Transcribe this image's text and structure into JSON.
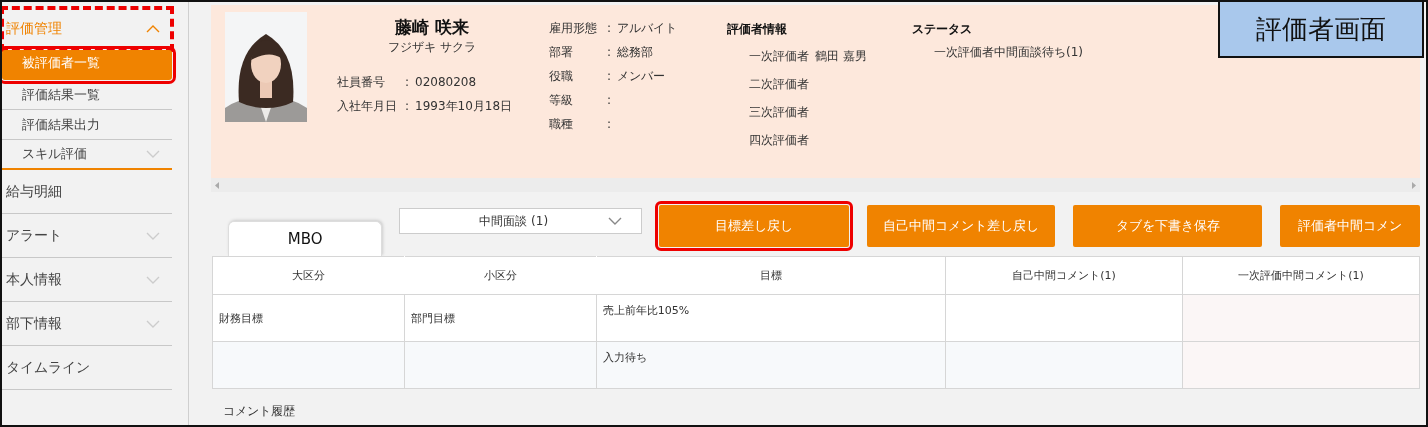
{
  "annotation_label": "評価者画面",
  "sidebar": {
    "items": [
      {
        "kind": "group",
        "label": "評価管理",
        "expanded": true,
        "annotated": true,
        "children": [
          {
            "label": "被評価者一覧",
            "selected": true,
            "annotated": true,
            "expandable": false
          },
          {
            "label": "評価結果一覧",
            "selected": false,
            "annotated": false,
            "expandable": false
          },
          {
            "label": "評価結果出力",
            "selected": false,
            "annotated": false,
            "expandable": false
          },
          {
            "label": "スキル評価",
            "selected": false,
            "annotated": false,
            "expandable": true
          }
        ]
      },
      {
        "kind": "link",
        "label": "給与明細",
        "annotated": false
      },
      {
        "kind": "group",
        "label": "アラート",
        "expanded": false,
        "annotated": false
      },
      {
        "kind": "group",
        "label": "本人情報",
        "expanded": false,
        "annotated": false
      },
      {
        "kind": "group",
        "label": "部下情報",
        "expanded": false,
        "annotated": false
      },
      {
        "kind": "link",
        "label": "タイムライン",
        "annotated": false
      }
    ]
  },
  "profile": {
    "name": "藤崎 咲来",
    "kana": "フジザキ サクラ",
    "id_fields": [
      {
        "label": "社員番号",
        "colon": ":",
        "value": "02080208"
      },
      {
        "label": "入社年月日",
        "colon": ":",
        "value": "1993年10月18日"
      }
    ],
    "job_fields": [
      {
        "label": "雇用形態",
        "colon": ":",
        "value": "アルバイト"
      },
      {
        "label": "部署",
        "colon": ":",
        "value": "総務部"
      },
      {
        "label": "役職",
        "colon": ":",
        "value": "メンバー"
      },
      {
        "label": "等級",
        "colon": ":"
      },
      {
        "label": "職種",
        "colon": ":"
      }
    ],
    "evaluators": {
      "title": "評価者情報",
      "rows": [
        {
          "label": "一次評価者",
          "name": "鶴田 嘉男"
        },
        {
          "label": "二次評価者"
        },
        {
          "label": "三次評価者"
        },
        {
          "label": "四次評価者"
        }
      ]
    },
    "status": {
      "title": "ステータス",
      "items": [
        "一次評価者中間面談待ち(1)"
      ]
    }
  },
  "tabs": [
    {
      "label": "MBO",
      "selected": true
    }
  ],
  "phase_select": {
    "value": "中間面談 (1)"
  },
  "buttons": [
    {
      "label": "目標差し戻し",
      "annotated": true
    },
    {
      "label": "自己中間コメント差し戻し",
      "annotated": false
    },
    {
      "label": "タブを下書き保存",
      "annotated": false
    },
    {
      "label": "評価者中間コメン",
      "annotated": false
    }
  ],
  "table": {
    "columns": [
      "大区分",
      "小区分",
      "目標",
      "自己中間コメント(1)",
      "一次評価中間コメント(1)"
    ],
    "rows": [
      [
        "財務目標",
        "部門目標",
        "売上前年比105%",
        "",
        ""
      ],
      [
        "",
        "",
        "入力待ち",
        "",
        ""
      ]
    ]
  },
  "comment_history": {
    "title": "コメント履歴"
  }
}
